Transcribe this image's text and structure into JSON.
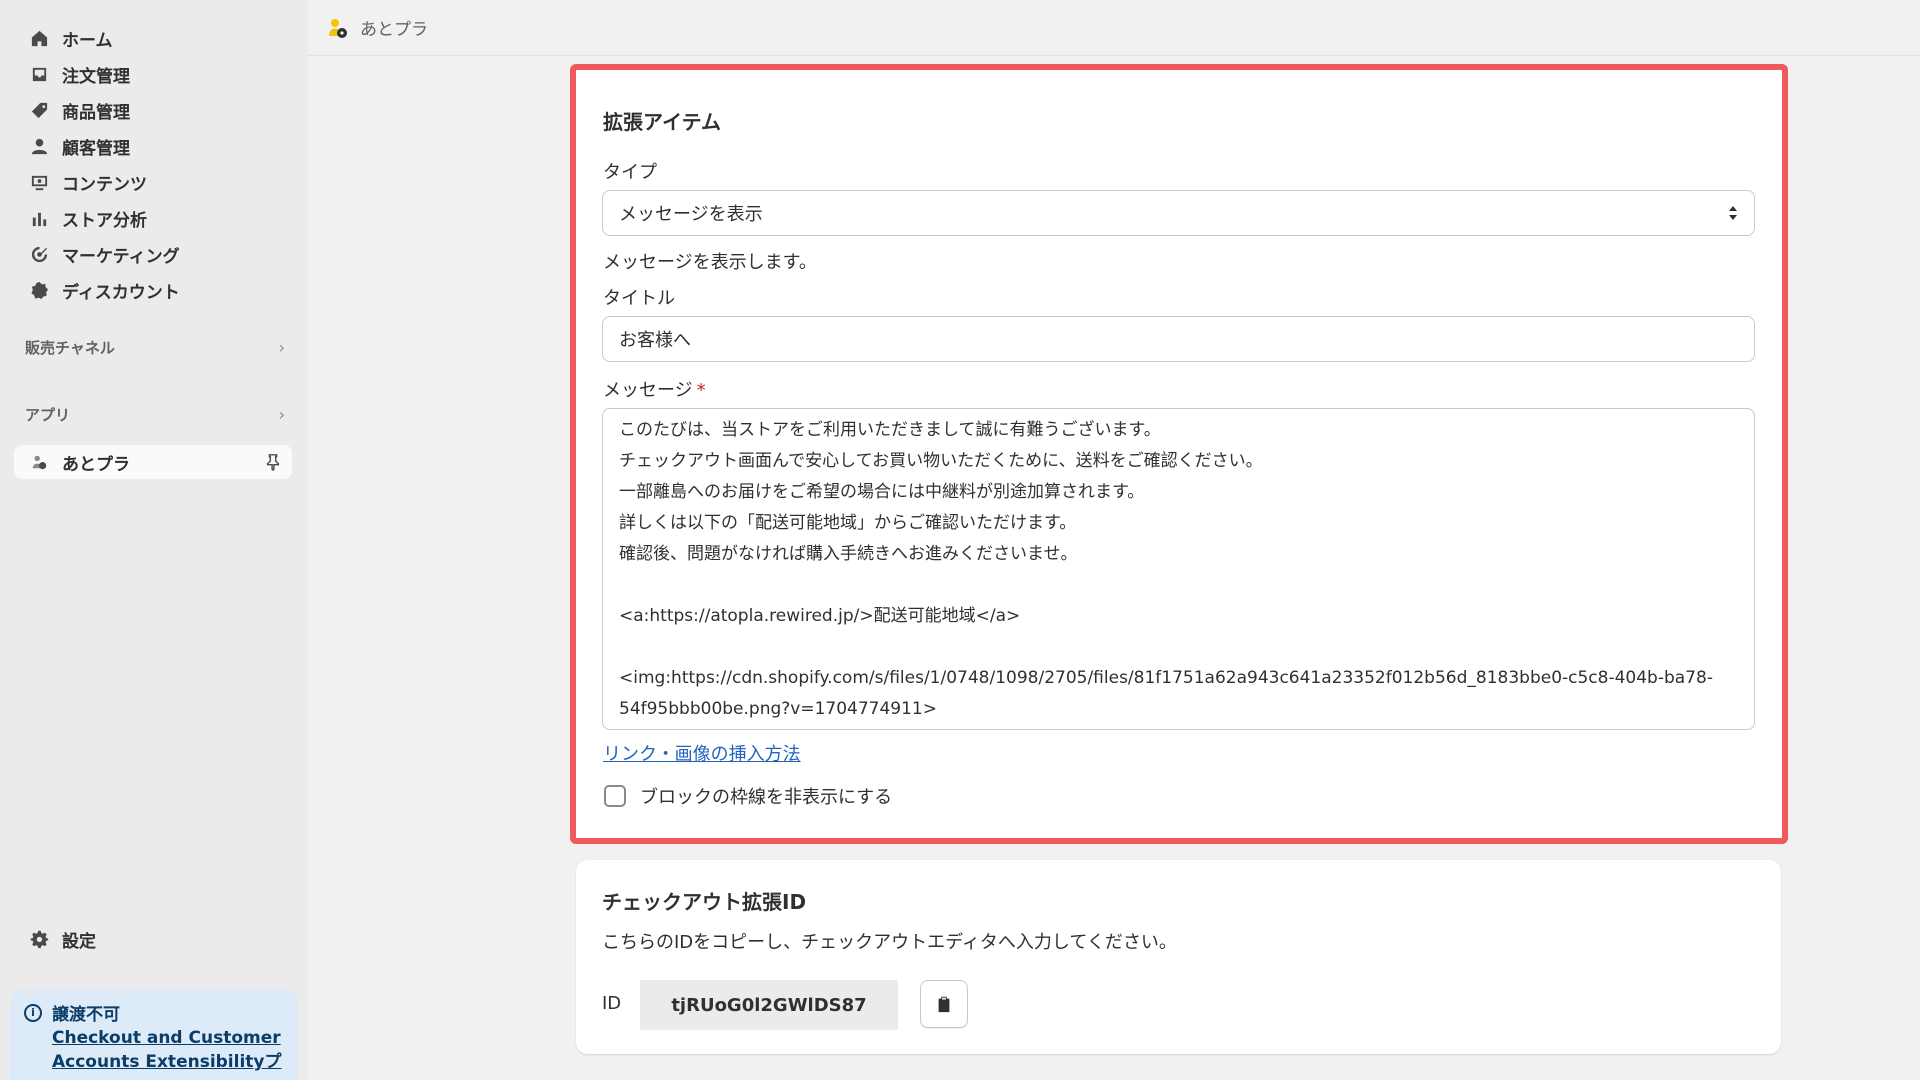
{
  "sidebar": {
    "items": [
      {
        "label": "ホーム",
        "icon": "home-icon"
      },
      {
        "label": "注文管理",
        "icon": "inbox-icon"
      },
      {
        "label": "商品管理",
        "icon": "tag-icon"
      },
      {
        "label": "顧客管理",
        "icon": "person-icon"
      },
      {
        "label": "コンテンツ",
        "icon": "content-icon"
      },
      {
        "label": "ストア分析",
        "icon": "bar-chart-icon"
      },
      {
        "label": "マーケティング",
        "icon": "target-icon"
      },
      {
        "label": "ディスカウント",
        "icon": "discount-icon"
      }
    ],
    "sales_channels": "販売チャネル",
    "apps": "アプリ",
    "app_item": "あとプラ",
    "settings": "設定",
    "notice": {
      "title": "譲渡不可",
      "link_line1": "Checkout and Customer",
      "link_line2": "Accounts Extensibilityプレ"
    }
  },
  "topbar": {
    "app_name": "あとプラ"
  },
  "extension_card": {
    "title": "拡張アイテム",
    "type_label": "タイプ",
    "type_value": "メッセージを表示",
    "type_help": "メッセージを表示します。",
    "title_label": "タイトル",
    "title_value": "お客様へ",
    "message_label": "メッセージ",
    "required_mark": "*",
    "message_lines": [
      "このたびは、当ストアをご利用いただきまして誠に有難うございます。",
      "チェックアウト画面んで安心してお買い物いただくために、送料をご確認ください。",
      "一部離島へのお届けをご希望の場合には中継料が別途加算されます。",
      "詳しくは以下の「配送可能地域」からご確認いただけます。",
      "確認後、問題がなければ購入手続きへお進みくださいませ。",
      "",
      "<a:https://atopla.rewired.jp/>配送可能地域</a>",
      "",
      "<img:https://cdn.shopify.com/s/files/1/0748/1098/2705/files/81f1751a62a943c641a23352f012b56d_8183bbe0-c5c8-404b-ba78-",
      "54f95bbb00be.png?v=1704774911>"
    ],
    "insert_link": "リンク・画像の挿入方法",
    "hide_border_label": "ブロックの枠線を非表示にする",
    "hide_border_checked": false
  },
  "id_card": {
    "title": "チェックアウト拡張ID",
    "description": "こちらのIDをコピーし、チェックアウトエディタへ入力してください。",
    "id_label": "ID",
    "id_value": "tjRUoG0l2GWlDS87"
  },
  "colors": {
    "highlight_border": "#f05a5f",
    "link": "#2463bc",
    "notice_bg": "#dcebf7"
  }
}
